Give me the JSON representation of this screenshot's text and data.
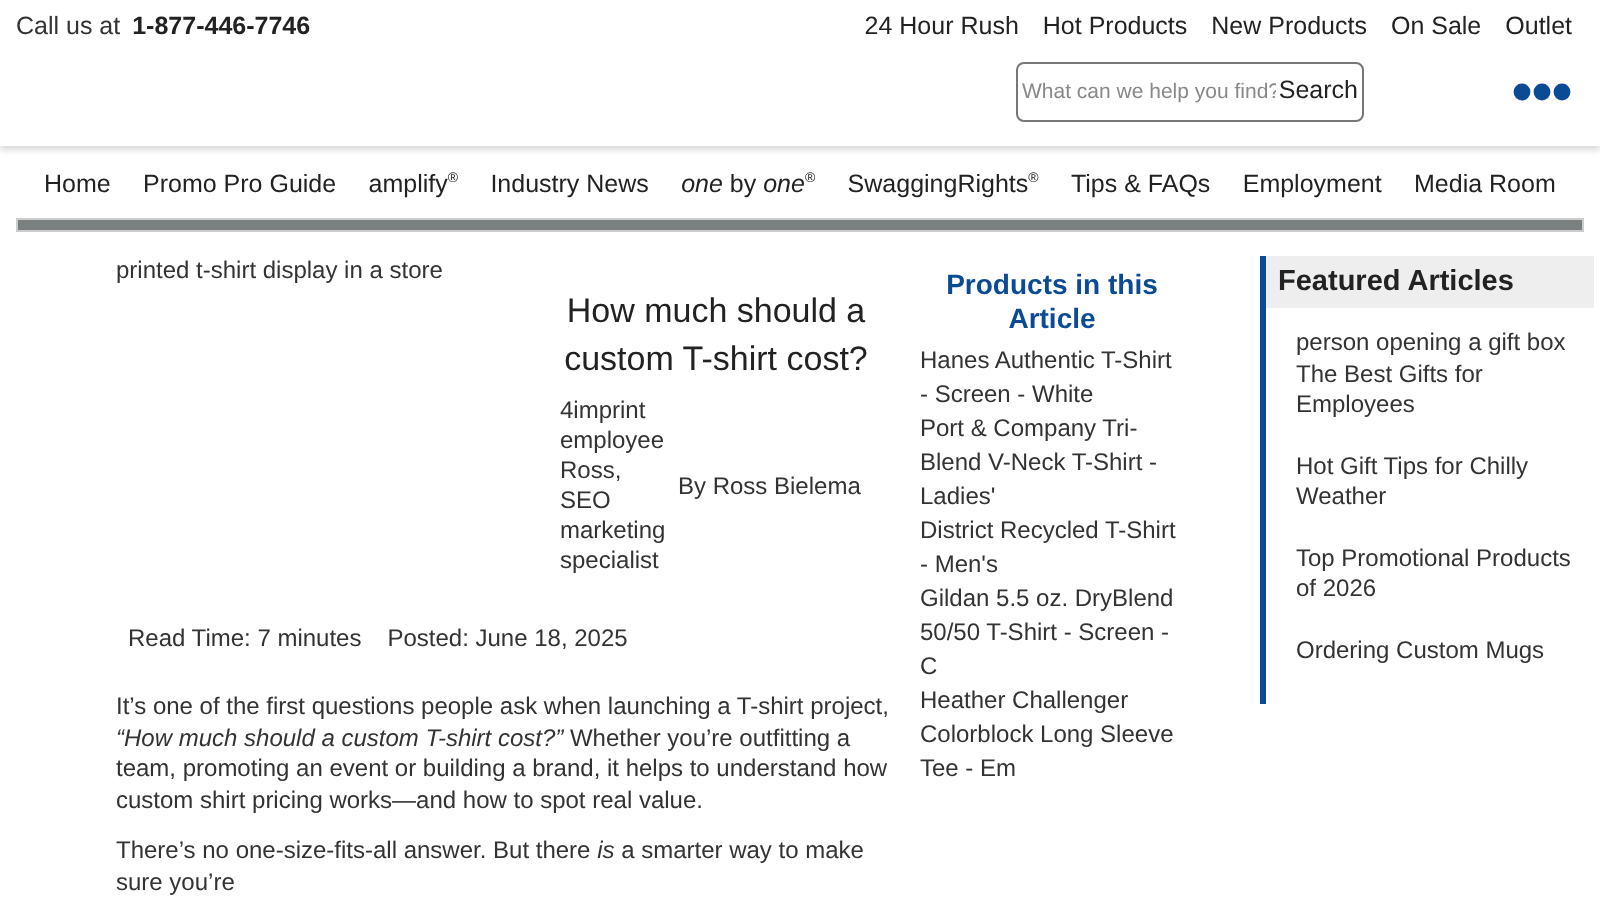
{
  "top_bar": {
    "call_label": "Call us at",
    "phone": "1-877-446-7746",
    "links": [
      "24 Hour Rush",
      "Hot Products",
      "New Products",
      "On Sale",
      "Outlet"
    ]
  },
  "search": {
    "placeholder": "What can we help you find?",
    "button": "Search"
  },
  "nav": [
    "Home",
    "Promo Pro Guide",
    "amplify$^{®}$",
    "Industry News",
    "*one* by *one*$^{®}$",
    "SwaggingRights$^{®}$",
    "Tips & FAQs",
    "Employment",
    "Media Room"
  ],
  "article": {
    "image_alt": "printed t-shirt display in a store",
    "title": "How much should a custom T-shirt cost?",
    "author_image_alt": "4imprint employee Ross, SEO marketing specialist",
    "byline": "By Ross Bielema",
    "read_time": "Read Time: 7 minutes",
    "posted": "Posted: June 18, 2025",
    "paragraphs": [
      "It’s one of the first questions people ask when launching a T-shirt project, *“How much should a custom T-shirt cost?”* Whether you’re outfitting a team, promoting an event or building a brand, it helps to understand how custom shirt pricing works—and how to spot real value.",
      "There’s no one-size-fits-all answer. But there *is* a smarter way to make sure you’re"
    ]
  },
  "products": {
    "title": "Products in this Article",
    "items": [
      "Hanes Authentic T-Shirt - Screen - White",
      "Port & Company Tri-Blend V-Neck T-Shirt - Ladies'",
      "District Recycled T-Shirt - Men's",
      "Gildan 5.5 oz. DryBlend 50/50 T-Shirt - Screen - C",
      "Heather Challenger Colorblock Long Sleeve Tee - Em"
    ]
  },
  "featured": {
    "title": "Featured Articles",
    "items": [
      "person opening a gift box The Best Gifts for Employees",
      "Hot Gift Tips for Chilly Weather",
      "Top Promotional Products of 2026",
      "Ordering Custom Mugs"
    ]
  }
}
